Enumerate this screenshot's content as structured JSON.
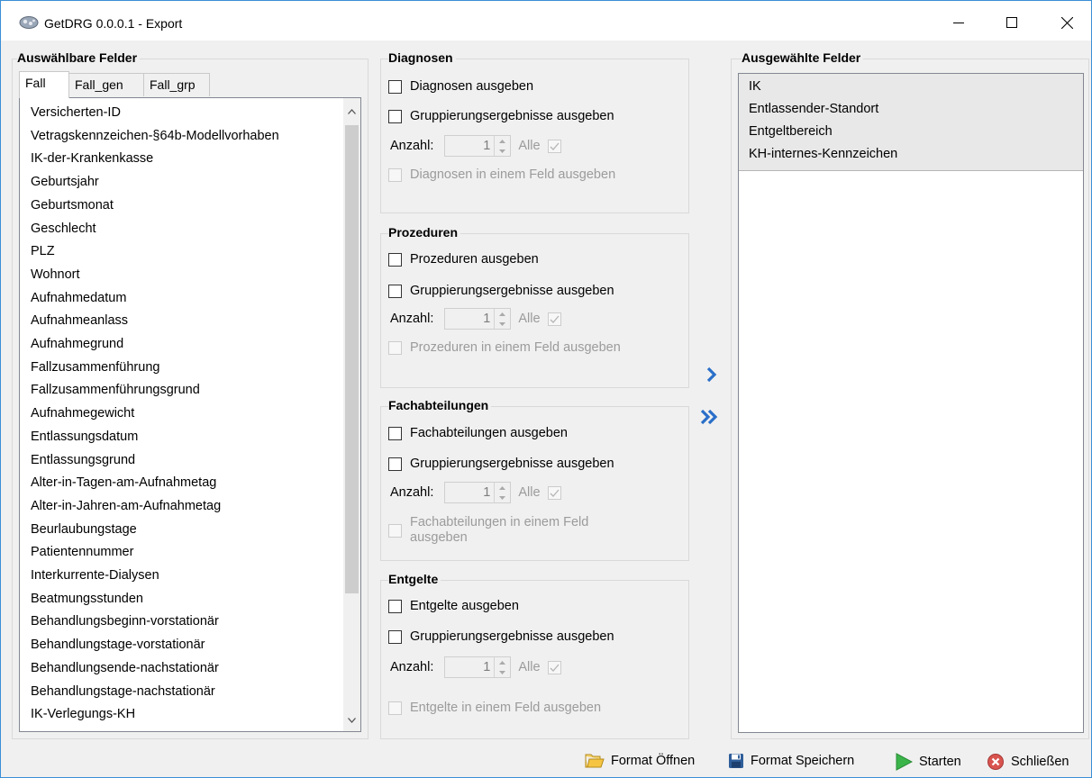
{
  "window": {
    "title": "GetDRG 0.0.0.1 - Export",
    "controls": {
      "minimize": "minimize",
      "maximize": "maximize",
      "close": "close"
    }
  },
  "left": {
    "group_title": "Auswählbare Felder",
    "tabs": [
      {
        "label": "Fall",
        "active": true
      },
      {
        "label": "Fall_gen",
        "active": false
      },
      {
        "label": "Fall_grp",
        "active": false
      }
    ],
    "items": [
      "Versicherten-ID",
      "Vetragskennzeichen-§64b-Modellvorhaben",
      "IK-der-Krankenkasse",
      "Geburtsjahr",
      "Geburtsmonat",
      "Geschlecht",
      "PLZ",
      "Wohnort",
      "Aufnahmedatum",
      "Aufnahmeanlass",
      "Aufnahmegrund",
      "Fallzusammenführung",
      "Fallzusammenführungsgrund",
      "Aufnahmegewicht",
      "Entlassungsdatum",
      "Entlassungsgrund",
      "Alter-in-Tagen-am-Aufnahmetag",
      "Alter-in-Jahren-am-Aufnahmetag",
      "Beurlaubungstage",
      "Patientennummer",
      "Interkurrente-Dialysen",
      "Beatmungsstunden",
      "Behandlungsbeginn-vorstationär",
      "Behandlungstage-vorstationär",
      "Behandlungsende-nachstationär",
      "Behandlungstage-nachstationär",
      "IK-Verlegungs-KH"
    ]
  },
  "sections": {
    "diagnosen": {
      "title": "Diagnosen",
      "output_label": "Diagnosen ausgeben",
      "group_label": "Gruppierungsergebnisse ausgeben",
      "anzahl_label": "Anzahl:",
      "anzahl_value": "1",
      "alle_label": "Alle",
      "single_field_label": "Diagnosen in einem Feld ausgeben"
    },
    "prozeduren": {
      "title": "Prozeduren",
      "output_label": "Prozeduren ausgeben",
      "group_label": "Gruppierungsergebnisse ausgeben",
      "anzahl_label": "Anzahl:",
      "anzahl_value": "1",
      "alle_label": "Alle",
      "single_field_label": "Prozeduren in einem Feld ausgeben"
    },
    "fachabteilungen": {
      "title": "Fachabteilungen",
      "output_label": "Fachabteilungen ausgeben",
      "group_label": "Gruppierungsergebnisse ausgeben",
      "anzahl_label": "Anzahl:",
      "anzahl_value": "1",
      "alle_label": "Alle",
      "single_field_label_1": "Fachabteilungen in einem Feld",
      "single_field_label_2": "ausgeben"
    },
    "entgelte": {
      "title": "Entgelte",
      "output_label": "Entgelte ausgeben",
      "group_label": "Gruppierungsergebnisse ausgeben",
      "anzahl_label": "Anzahl:",
      "anzahl_value": "1",
      "alle_label": "Alle",
      "single_field_label": "Entgelte in einem Feld ausgeben"
    }
  },
  "right": {
    "group_title": "Ausgewählte Felder",
    "items": [
      "IK",
      "Entlassender-Standort",
      "Entgeltbereich",
      "KH-internes-Kennzeichen"
    ]
  },
  "toolbar": {
    "open_label": "Format Öffnen",
    "save_label": "Format Speichern",
    "start_label": "Starten",
    "close_label": "Schließen"
  },
  "icons": {
    "move_one": "chevron-right-icon",
    "move_all": "double-chevron-right-icon",
    "open": "folder-icon",
    "save": "floppy-disk-icon",
    "start": "play-icon",
    "close": "close-circle-icon"
  },
  "colors": {
    "accent_blue": "#2a6fc9",
    "start_green": "#3bb54a",
    "close_red": "#d9534f"
  }
}
